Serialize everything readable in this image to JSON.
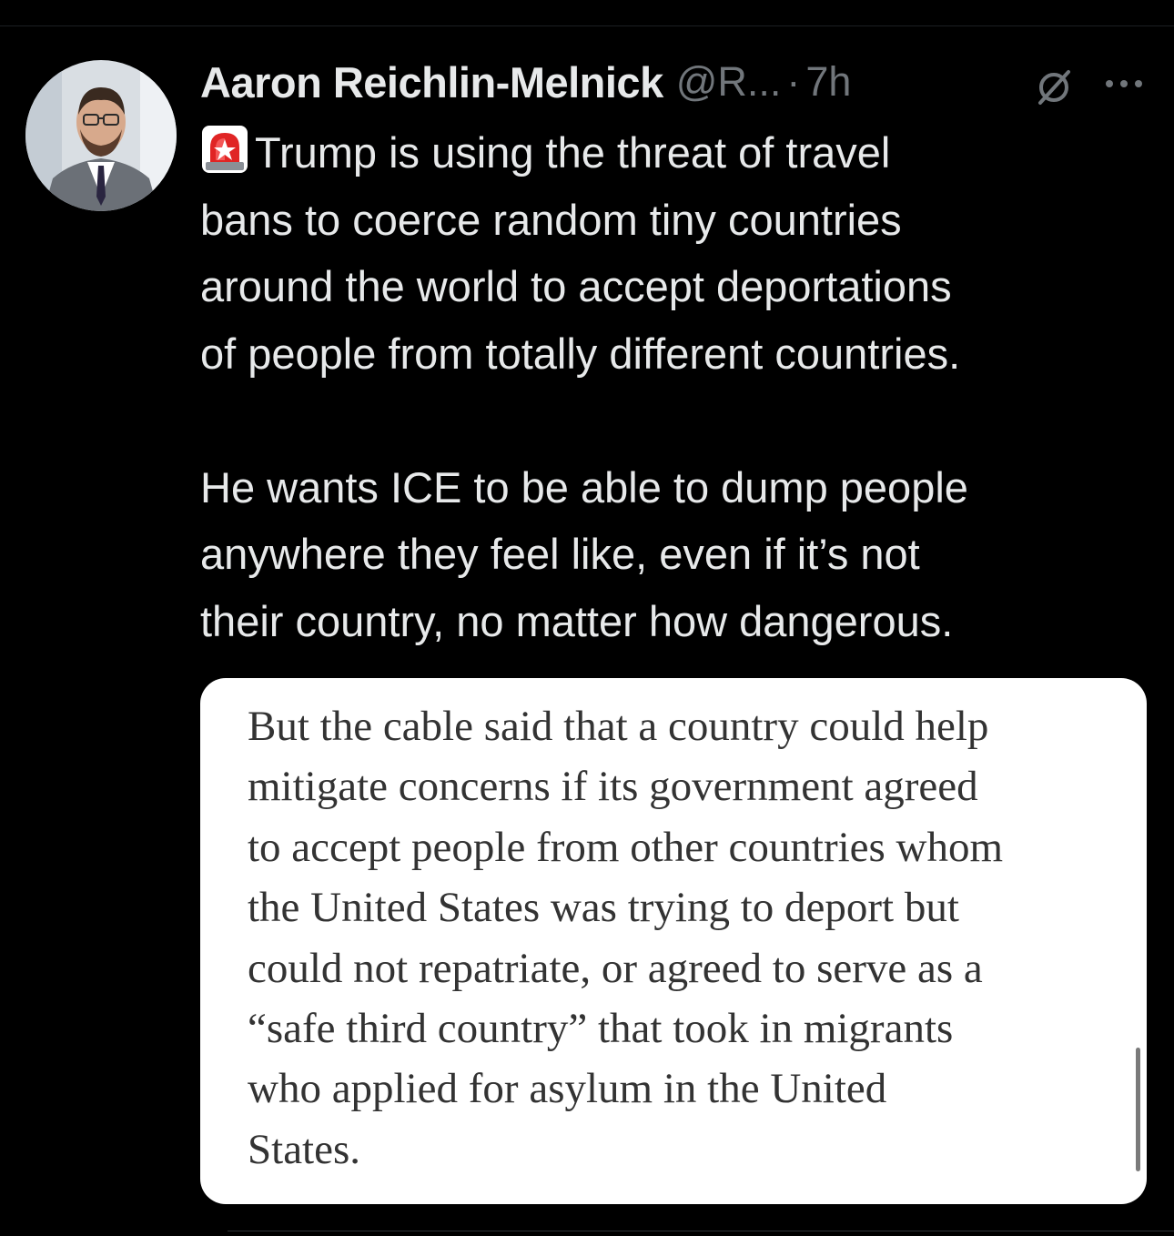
{
  "post": {
    "author": {
      "display_name": "Aaron Reichlin-Melnick",
      "handle": "@R...",
      "separator": "·",
      "time": "7h"
    },
    "icons": {
      "grok": "grok-slash-circle-icon",
      "more": "more-options-icon",
      "siren": "rotating-light-emoji-icon"
    },
    "text": {
      "line1": "Trump is using the threat of travel",
      "line2": "bans to coerce random tiny countries",
      "line3": "around the world to accept deportations",
      "line4": "of people from totally different countries.",
      "line5": "He wants ICE to be able to dump people",
      "line6": "anywhere they feel like, even if it’s not",
      "line7": "their country, no matter how dangerous."
    },
    "quote_image": {
      "lines": [
        "But the cable said that a country could help",
        "mitigate concerns if its government agreed",
        "to accept people from other countries whom",
        "the United States was trying to deport but",
        "could not repatriate, or agreed to serve as a",
        "“safe third country” that took in migrants",
        "who applied for asylum in the United",
        "States."
      ]
    }
  }
}
